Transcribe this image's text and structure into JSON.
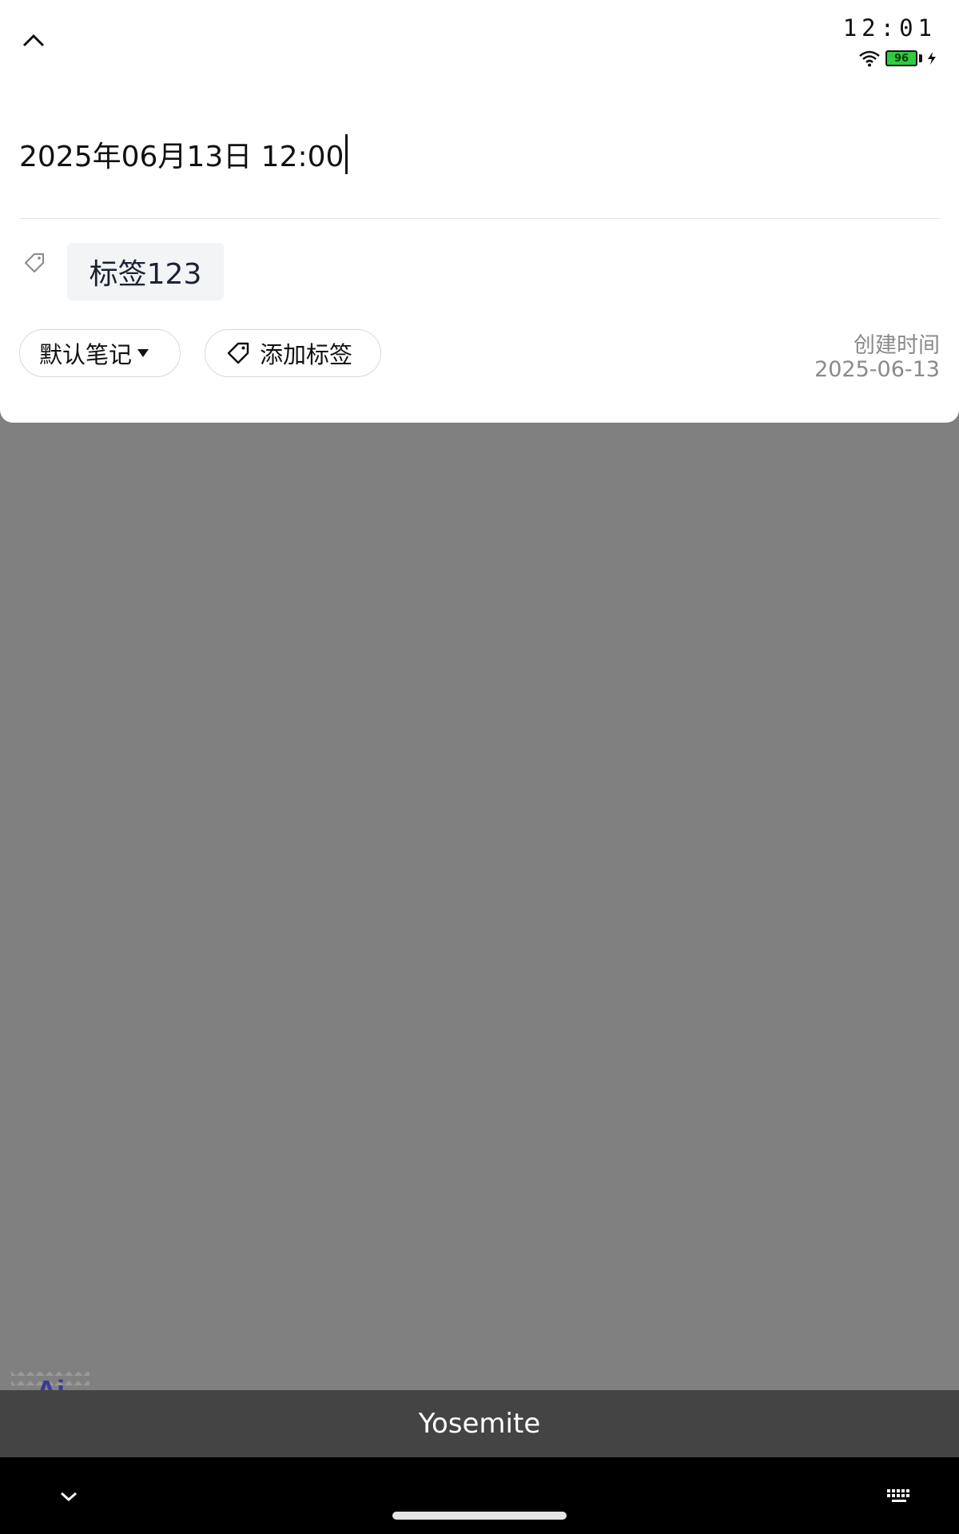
{
  "status_bar": {
    "time": "12:01",
    "battery_level": "96",
    "icons": [
      "wifi-icon",
      "battery-icon",
      "charging-icon"
    ]
  },
  "header": {
    "collapse_icon": "chevron-up-icon"
  },
  "note": {
    "title_value": "2025年06月13日 12:00",
    "tags": [
      {
        "label": "标签123"
      }
    ],
    "tag_icon": "tag-icon"
  },
  "actions": {
    "notebook_label": "默认笔记",
    "add_tag_label": "添加标签"
  },
  "meta": {
    "created_label": "创建时间",
    "created_date": "2025-06-13"
  },
  "ai_badge": {
    "label": "Ai"
  },
  "keyboard_bar": {
    "label": "Yosemite"
  },
  "colors": {
    "overlay": "#808080",
    "card": "#ffffff",
    "chip_bg": "#f3f4f6",
    "muted_text": "#8a8a8a",
    "battery": "#2ecc40",
    "keyboard_bar": "#444444"
  }
}
